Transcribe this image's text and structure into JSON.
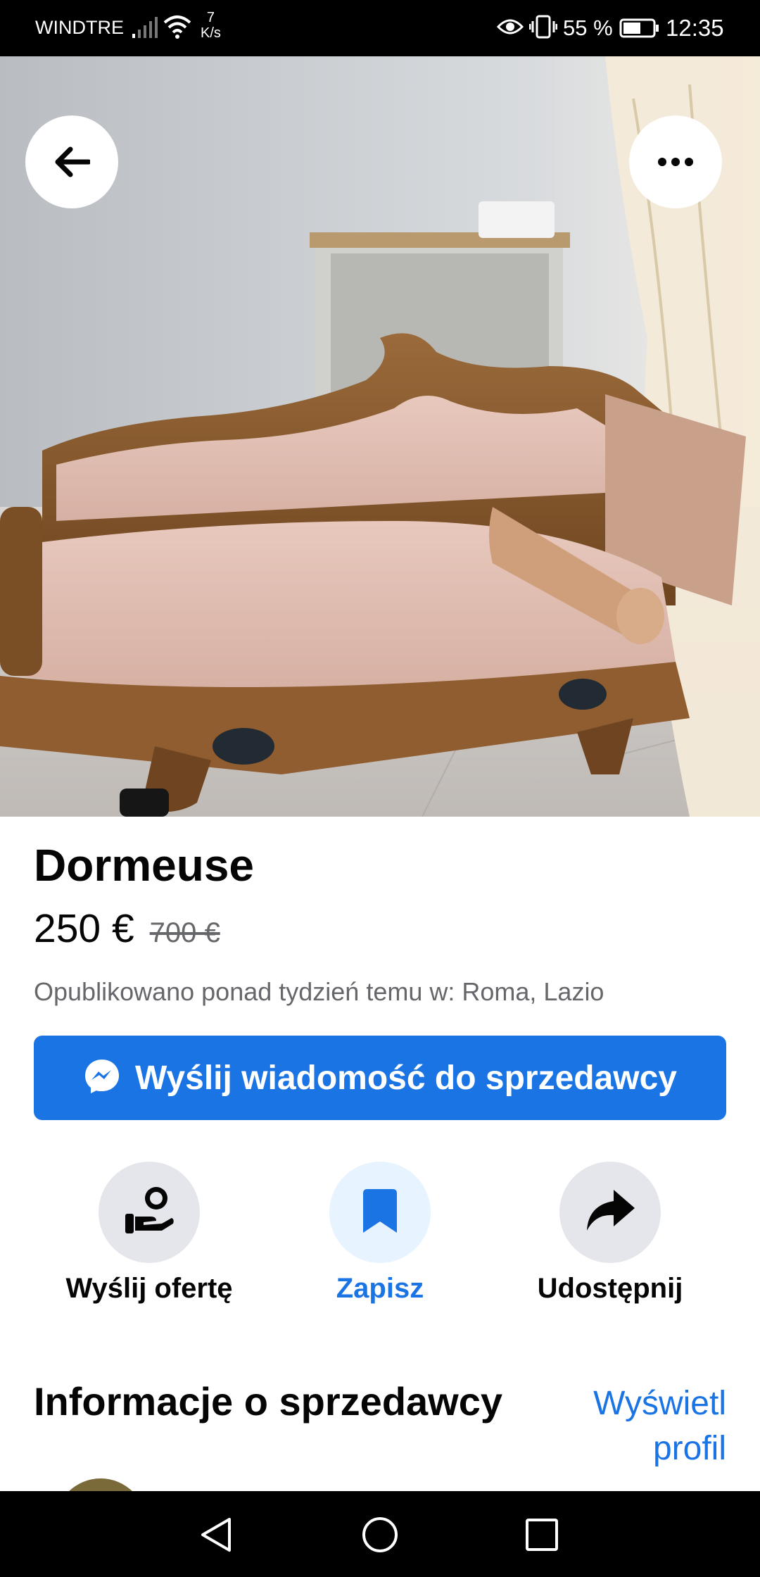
{
  "status_bar": {
    "carrier": "WINDTRE",
    "speed_value": "7",
    "speed_unit": "K/s",
    "battery_percent": "55 %",
    "time": "12:35"
  },
  "listing": {
    "title": "Dormeuse",
    "price": "250 €",
    "original_price": "700 €",
    "posted": "Opublikowano ponad tydzień temu w: Roma, Lazio",
    "message_button": "Wyślij wiadomość do sprzedawcy"
  },
  "actions": [
    {
      "label": "Wyślij ofertę",
      "icon": "send-offer-icon"
    },
    {
      "label": "Zapisz",
      "icon": "bookmark-icon",
      "active": true
    },
    {
      "label": "Udostępnij",
      "icon": "share-icon"
    }
  ],
  "seller_section": {
    "title": "Informacje o sprzedawcy",
    "view_profile": "Wyświetl profil"
  },
  "colors": {
    "accent": "#1b74e4",
    "text_primary": "#050505",
    "text_secondary": "#65676b",
    "icon_bg": "#e4e6eb"
  }
}
